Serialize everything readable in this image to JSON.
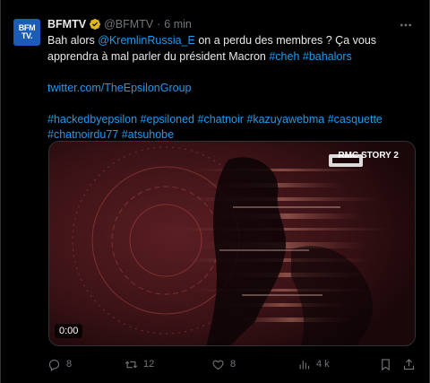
{
  "tweet": {
    "author_name": "BFMTV",
    "author_handle": "@BFMTV",
    "separator": "·",
    "time": "6 min",
    "avatar_text_line1": "BFM",
    "avatar_text_line2": "TV.",
    "body": {
      "line1_prefix": "Bah alors ",
      "mention": "@KremlinRussia_E",
      "line1_suffix": " on a perdu des membres ? Ça vous apprendra à mal parler du président Macron ",
      "hashtag1": "#cheh",
      "hashtag2": "#bahalors",
      "url": "twitter.com/TheEpsilonGroup",
      "tags_line1": "#hackedbyepsilon #epsiloned #chatnoir #kazuyawebma #casquette",
      "tags_line2": "#chatnoirdu77 #atsuhobe"
    },
    "media": {
      "timecode": "0:00",
      "channel_logo": "RMC STORY 2"
    },
    "actions": {
      "reply_count": "8",
      "retweet_count": "12",
      "like_count": "8",
      "views_count": "4 k"
    }
  },
  "colors": {
    "background": "#000000",
    "text": "#e7e9ea",
    "muted": "#71767b",
    "link": "#1d9bf0",
    "verified": "#e2b719",
    "avatar": "#1b5cb7"
  }
}
